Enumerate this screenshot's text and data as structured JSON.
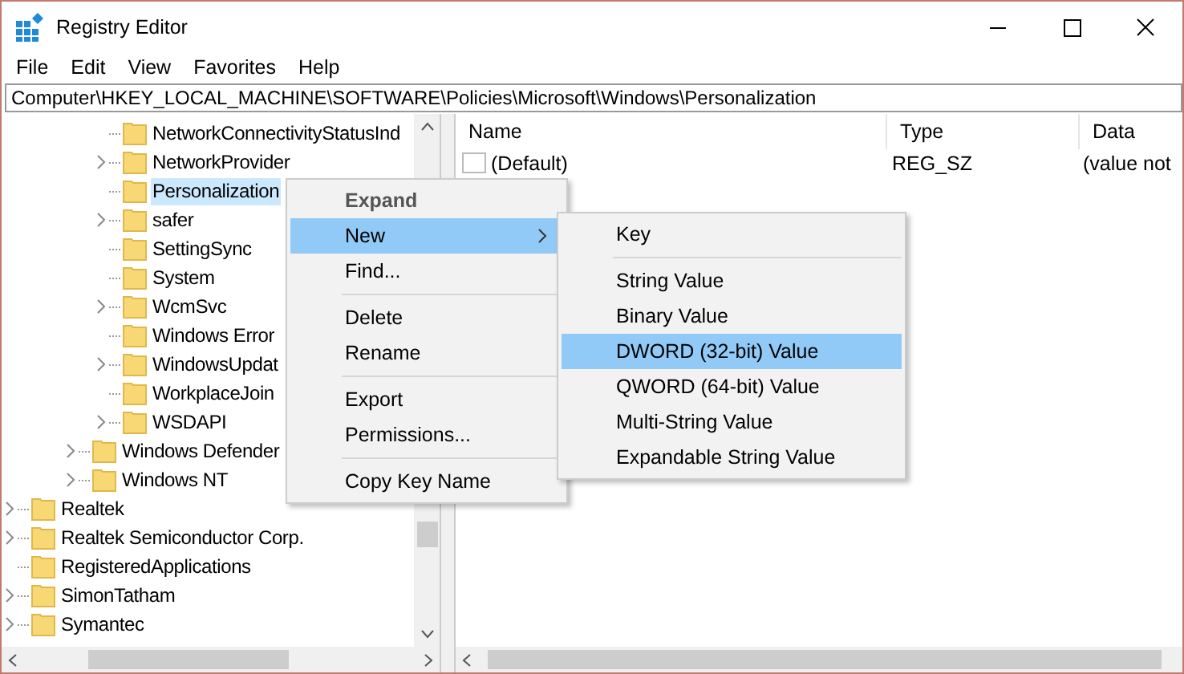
{
  "window": {
    "title": "Registry Editor"
  },
  "menu_bar": [
    "File",
    "Edit",
    "View",
    "Favorites",
    "Help"
  ],
  "address": "Computer\\HKEY_LOCAL_MACHINE\\SOFTWARE\\Policies\\Microsoft\\Windows\\Personalization",
  "tree": {
    "items": [
      {
        "children": [
          {
            "children": [
              {
                "children": [
                  {
                    "label": "NetworkConnectivityStatusInd",
                    "expandable": false,
                    "selected": false
                  },
                  {
                    "label": "NetworkProvider",
                    "expandable": true,
                    "selected": false
                  },
                  {
                    "label": "Personalization",
                    "expandable": false,
                    "selected": true
                  },
                  {
                    "label": "safer",
                    "expandable": true,
                    "selected": false
                  },
                  {
                    "label": "SettingSync",
                    "expandable": false,
                    "selected": false
                  },
                  {
                    "label": "System",
                    "expandable": false,
                    "selected": false
                  },
                  {
                    "label": "WcmSvc",
                    "expandable": true,
                    "selected": false
                  },
                  {
                    "label": "Windows Error",
                    "expandable": false,
                    "selected": false
                  },
                  {
                    "label": "WindowsUpdat",
                    "expandable": true,
                    "selected": false
                  },
                  {
                    "label": "WorkplaceJoin",
                    "expandable": false,
                    "selected": false
                  },
                  {
                    "label": "WSDAPI",
                    "expandable": true,
                    "selected": false
                  }
                ]
              },
              {
                "label": "Windows Defender",
                "expandable": true,
                "selected": false
              },
              {
                "label": "Windows NT",
                "expandable": true,
                "selected": false
              }
            ]
          }
        ]
      },
      {
        "label": "Realtek",
        "expandable": true,
        "selected": false
      },
      {
        "label": "Realtek Semiconductor Corp.",
        "expandable": true,
        "selected": false
      },
      {
        "label": "RegisteredApplications",
        "expandable": false,
        "selected": false
      },
      {
        "label": "SimonTatham",
        "expandable": true,
        "selected": false
      },
      {
        "label": "Symantec",
        "expandable": true,
        "selected": false
      }
    ]
  },
  "values_table": {
    "columns": [
      "Name",
      "Type",
      "Data"
    ],
    "rows": [
      {
        "name": "(Default)",
        "type": "REG_SZ",
        "data": "(value not"
      }
    ]
  },
  "context_menu": {
    "items": [
      {
        "kind": "item",
        "label": "Expand",
        "default": true,
        "selected": false,
        "submenu": false
      },
      {
        "kind": "item",
        "label": "New",
        "default": false,
        "selected": true,
        "submenu": true
      },
      {
        "kind": "item",
        "label": "Find...",
        "default": false,
        "selected": false,
        "submenu": false
      },
      {
        "kind": "separator"
      },
      {
        "kind": "item",
        "label": "Delete",
        "default": false,
        "selected": false,
        "submenu": false
      },
      {
        "kind": "item",
        "label": "Rename",
        "default": false,
        "selected": false,
        "submenu": false
      },
      {
        "kind": "separator"
      },
      {
        "kind": "item",
        "label": "Export",
        "default": false,
        "selected": false,
        "submenu": false
      },
      {
        "kind": "item",
        "label": "Permissions...",
        "default": false,
        "selected": false,
        "submenu": false
      },
      {
        "kind": "separator"
      },
      {
        "kind": "item",
        "label": "Copy Key Name",
        "default": false,
        "selected": false,
        "submenu": false
      }
    ]
  },
  "submenu": {
    "items": [
      {
        "kind": "item",
        "label": "Key",
        "selected": false
      },
      {
        "kind": "separator"
      },
      {
        "kind": "item",
        "label": "String Value",
        "selected": false
      },
      {
        "kind": "item",
        "label": "Binary Value",
        "selected": false
      },
      {
        "kind": "item",
        "label": "DWORD (32-bit) Value",
        "selected": true
      },
      {
        "kind": "item",
        "label": "QWORD (64-bit) Value",
        "selected": false
      },
      {
        "kind": "item",
        "label": "Multi-String Value",
        "selected": false
      },
      {
        "kind": "item",
        "label": "Expandable String Value",
        "selected": false
      }
    ]
  }
}
